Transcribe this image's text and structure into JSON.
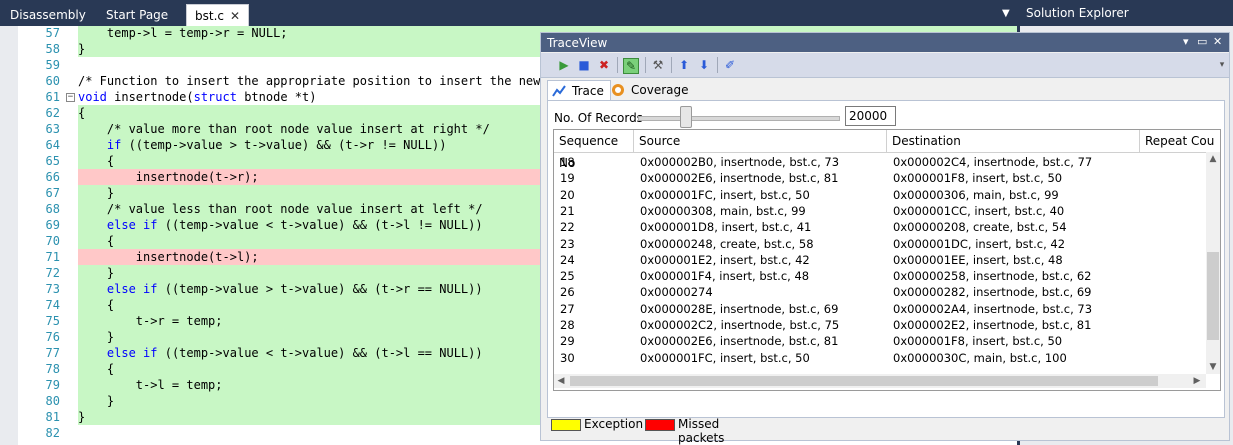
{
  "tabs": [
    {
      "label": "Disassembly"
    },
    {
      "label": "Start Page"
    },
    {
      "label": "bst.c",
      "close": "✕"
    }
  ],
  "solution_explorer": {
    "title": "Solution Explorer"
  },
  "editor": {
    "lines": [
      {
        "n": "57",
        "code": "    temp->l = temp->r = NULL;",
        "hl": "green"
      },
      {
        "n": "58",
        "code": "}",
        "hl": "green"
      },
      {
        "n": "59",
        "code": "",
        "hl": ""
      },
      {
        "n": "60",
        "code": "/* Function to insert the appropriate position to insert the new n",
        "hl": "",
        "type": "comment"
      },
      {
        "n": "61",
        "code": "void insertnode(struct btnode *t)",
        "hl": "",
        "type": "kwfirst",
        "fold": "−"
      },
      {
        "n": "62",
        "code": "{",
        "hl": "green"
      },
      {
        "n": "63",
        "code": "    /* value more than root node value insert at right */",
        "hl": "green",
        "type": "comment"
      },
      {
        "n": "64",
        "code": "    if ((temp->value > t->value) && (t->r != NULL))",
        "hl": "green"
      },
      {
        "n": "65",
        "code": "    {",
        "hl": "green"
      },
      {
        "n": "66",
        "code": "        insertnode(t->r);",
        "hl": "red"
      },
      {
        "n": "67",
        "code": "    }",
        "hl": "green"
      },
      {
        "n": "68",
        "code": "    /* value less than root node value insert at left */",
        "hl": "green",
        "type": "comment"
      },
      {
        "n": "69",
        "code": "    else if ((temp->value < t->value) && (t->l != NULL))",
        "hl": "green"
      },
      {
        "n": "70",
        "code": "    {",
        "hl": "green"
      },
      {
        "n": "71",
        "code": "        insertnode(t->l);",
        "hl": "red"
      },
      {
        "n": "72",
        "code": "    }",
        "hl": "green"
      },
      {
        "n": "73",
        "code": "    else if ((temp->value > t->value) && (t->r == NULL))",
        "hl": "green"
      },
      {
        "n": "74",
        "code": "    {",
        "hl": "green"
      },
      {
        "n": "75",
        "code": "        t->r = temp;",
        "hl": "green"
      },
      {
        "n": "76",
        "code": "    }",
        "hl": "green"
      },
      {
        "n": "77",
        "code": "    else if ((temp->value < t->value) && (t->l == NULL))",
        "hl": "green"
      },
      {
        "n": "78",
        "code": "    {",
        "hl": "green"
      },
      {
        "n": "79",
        "code": "        t->l = temp;",
        "hl": "green"
      },
      {
        "n": "80",
        "code": "    }",
        "hl": "green"
      },
      {
        "n": "81",
        "code": "}",
        "hl": "green"
      },
      {
        "n": "82",
        "code": "",
        "hl": ""
      }
    ]
  },
  "traceview": {
    "title": "TraceView",
    "controls": {
      "pin": "▾",
      "dock": "▭",
      "close": "✕"
    },
    "subtabs": [
      {
        "label": "Trace"
      },
      {
        "label": "Coverage"
      }
    ],
    "records_label": "No. Of Records",
    "records_value": "20000",
    "columns": [
      "Sequence No",
      "Source",
      "Destination",
      "Repeat Cou"
    ],
    "rows": [
      [
        "18",
        "0x000002B0, insertnode, bst.c, 73",
        "0x000002C4, insertnode, bst.c, 77"
      ],
      [
        "19",
        "0x000002E6, insertnode, bst.c, 81",
        "0x000001F8, insert, bst.c, 50"
      ],
      [
        "20",
        "0x000001FC, insert, bst.c, 50",
        "0x00000306, main, bst.c, 99"
      ],
      [
        "21",
        "0x00000308, main, bst.c, 99",
        "0x000001CC, insert, bst.c, 40"
      ],
      [
        "22",
        "0x000001D8, insert, bst.c, 41",
        "0x00000208, create, bst.c, 54"
      ],
      [
        "23",
        "0x00000248, create, bst.c, 58",
        "0x000001DC, insert, bst.c, 42"
      ],
      [
        "24",
        "0x000001E2, insert, bst.c, 42",
        "0x000001EE, insert, bst.c, 48"
      ],
      [
        "25",
        "0x000001F4, insert, bst.c, 48",
        "0x00000258, insertnode, bst.c, 62"
      ],
      [
        "26",
        "0x00000274",
        "0x00000282, insertnode, bst.c, 69"
      ],
      [
        "27",
        "0x0000028E, insertnode, bst.c, 69",
        "0x000002A4, insertnode, bst.c, 73"
      ],
      [
        "28",
        "0x000002C2, insertnode, bst.c, 75",
        "0x000002E2, insertnode, bst.c, 81"
      ],
      [
        "29",
        "0x000002E6, insertnode, bst.c, 81",
        "0x000001F8, insert, bst.c, 50"
      ],
      [
        "30",
        "0x000001FC, insert, bst.c, 50",
        "0x0000030C, main, bst.c, 100"
      ]
    ],
    "legend": [
      {
        "label": "Exception",
        "color": "#ffff00"
      },
      {
        "label": "Missed packets",
        "color": "#ff0000"
      }
    ]
  }
}
